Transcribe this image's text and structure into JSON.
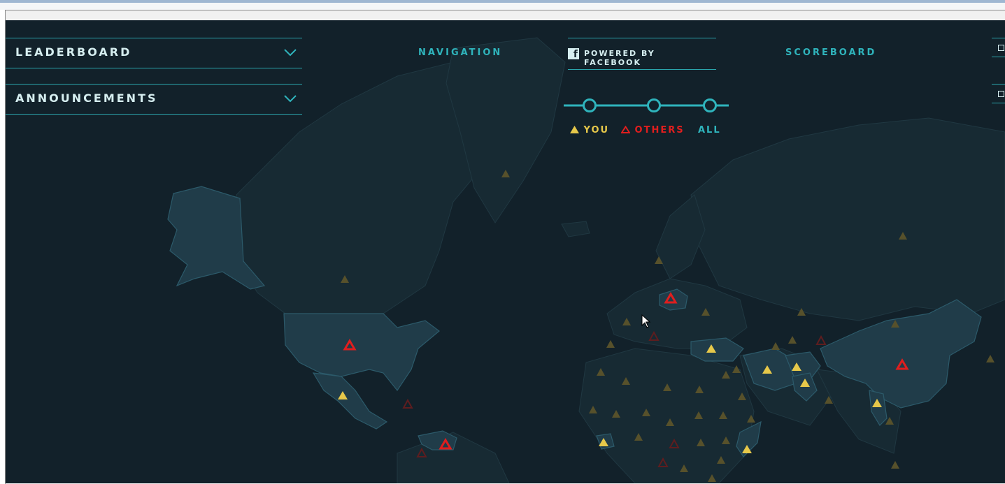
{
  "panels": {
    "leaderboard": "LEADERBOARD",
    "announcements": "ANNOUNCEMENTS"
  },
  "nav": {
    "navigation": "NAVIGATION",
    "powered_by": "POWERED BY FACEBOOK",
    "scoreboard": "SCOREBOARD",
    "facebook_icon": "f"
  },
  "filter": {
    "you": "YOU",
    "others": "OTHERS",
    "all": "ALL"
  },
  "colors": {
    "background": "#12212a",
    "accent": "#2fb4bc",
    "you": "#e6c84a",
    "others": "#e01e1e",
    "land_dim": "#1a2d36",
    "land_highlight": "#1f3d4b"
  },
  "icons": [
    "chevron-down-icon",
    "facebook-icon",
    "triangle-icon",
    "cursor-icon",
    "checkbox-icon"
  ]
}
